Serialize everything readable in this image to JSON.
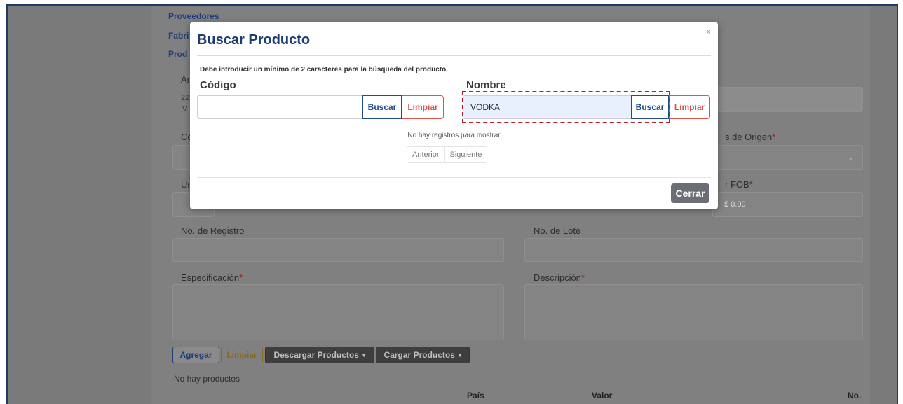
{
  "nav": {
    "proveedores": "Proveedores",
    "fabricantes": "Fabri",
    "productos": "Prod"
  },
  "background_form": {
    "arancel_label": "Ara",
    "arancel_code": "22",
    "arancel_sub": "V",
    "codigo_label": "Có",
    "pais_origen_label": "s de Origen",
    "unidad_label": "Uni",
    "valor_fob_label": "r FOB",
    "valor_fob_value": "$ 0.00",
    "registro_label": "No. de Registro",
    "lote_label": "No. de Lote",
    "especificacion_label": "Especificación",
    "descripcion_label": "Descripción",
    "required_mark": "*",
    "agregar_btn": "Agregar",
    "limpiar_btn": "Limpiar",
    "descargar_btn": "Descargar Productos",
    "cargar_btn": "Cargar Productos",
    "caret": "▾",
    "empty_products": "No hay productos",
    "table_headers": [
      "País",
      "Valor",
      "No."
    ]
  },
  "modal": {
    "title": "Buscar Producto",
    "close": "×",
    "hint": "Debe introducir un mínimo de 2 caracteres para la búsqueda del producto.",
    "codigo": {
      "label": "Código",
      "value": "",
      "buscar": "Buscar",
      "limpiar": "Limpiar"
    },
    "nombre": {
      "label": "Nombre",
      "value": "VODKA",
      "buscar": "Buscar",
      "limpiar": "Limpiar"
    },
    "no_records": "No hay registros para mostrar",
    "pager": {
      "prev": "Anterior",
      "next": "Siguiente"
    },
    "cerrar": "Cerrar"
  }
}
